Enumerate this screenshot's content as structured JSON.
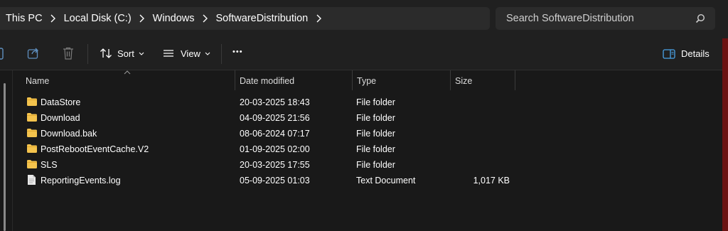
{
  "address": {
    "crumbs": [
      "This PC",
      "Local Disk (C:)",
      "Windows",
      "SoftwareDistribution"
    ],
    "search_placeholder": "Search SoftwareDistribution"
  },
  "toolbar": {
    "sort_label": "Sort",
    "view_label": "View",
    "more_label": "•••",
    "details_label": "Details"
  },
  "columns": [
    "Name",
    "Date modified",
    "Type",
    "Size"
  ],
  "files": [
    {
      "name": "DataStore",
      "date": "20-03-2025 18:43",
      "type": "File folder",
      "size": "",
      "icon": "folder-icon"
    },
    {
      "name": "Download",
      "date": "04-09-2025 21:56",
      "type": "File folder",
      "size": "",
      "icon": "folder-icon"
    },
    {
      "name": "Download.bak",
      "date": "08-06-2024 07:17",
      "type": "File folder",
      "size": "",
      "icon": "folder-icon"
    },
    {
      "name": "PostRebootEventCache.V2",
      "date": "01-09-2025 02:00",
      "type": "File folder",
      "size": "",
      "icon": "folder-icon"
    },
    {
      "name": "SLS",
      "date": "20-03-2025 17:55",
      "type": "File folder",
      "size": "",
      "icon": "folder-icon"
    },
    {
      "name": "ReportingEvents.log",
      "date": "05-09-2025 01:03",
      "type": "Text Document",
      "size": "1,017 KB",
      "icon": "text-document-icon"
    }
  ],
  "colors": {
    "folder": "#f4c34d",
    "background": "#191919",
    "toolbar": "#202020"
  }
}
